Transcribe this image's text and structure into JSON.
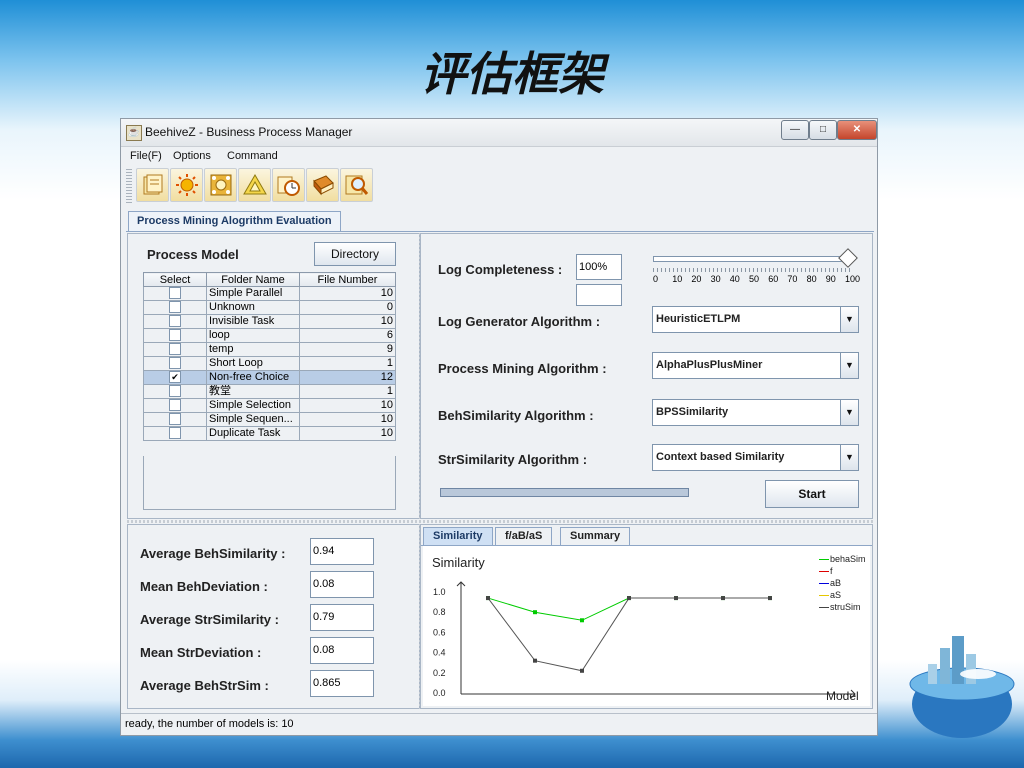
{
  "slide_title": "评估框架",
  "window": {
    "title": "BeehiveZ - Business Process Manager",
    "minimize": "—",
    "maximize": "□",
    "close": "✕"
  },
  "menu": [
    "File(F)",
    "Options",
    "Command"
  ],
  "toolbar_icons": [
    "document-icon",
    "sun-icon",
    "gear-icon",
    "triangle-icon",
    "clock-chart-icon",
    "book-icon",
    "magnifier-icon"
  ],
  "main_tab": "Process Mining Alogrithm Evaluation",
  "process_model": {
    "title": "Process Model",
    "directory_button": "Directory",
    "columns": [
      "Select",
      "Folder Name",
      "File Number"
    ],
    "rows": [
      {
        "checked": false,
        "name": "Simple Parallel",
        "count": "10"
      },
      {
        "checked": false,
        "name": "Unknown",
        "count": "0"
      },
      {
        "checked": false,
        "name": "Invisible Task",
        "count": "10"
      },
      {
        "checked": false,
        "name": "loop",
        "count": "6"
      },
      {
        "checked": false,
        "name": "temp",
        "count": "9"
      },
      {
        "checked": false,
        "name": "Short Loop",
        "count": "1"
      },
      {
        "checked": true,
        "name": "Non-free Choice",
        "count": "12"
      },
      {
        "checked": false,
        "name": "教堂",
        "count": "1"
      },
      {
        "checked": false,
        "name": "Simple Selection",
        "count": "10"
      },
      {
        "checked": false,
        "name": "Simple Sequen...",
        "count": "10"
      },
      {
        "checked": false,
        "name": "Duplicate Task",
        "count": "10"
      }
    ]
  },
  "settings": {
    "log_completeness_label": "Log Completeness :",
    "log_completeness_value": "100%",
    "log_completeness_extra": "",
    "slider_value": 100,
    "slider_ticks": [
      "0",
      "10",
      "20",
      "30",
      "40",
      "50",
      "60",
      "70",
      "80",
      "90",
      "100"
    ],
    "log_generator_label": "Log Generator Algorithm :",
    "log_generator_value": "HeuristicETLPM",
    "process_mining_label": "Process Mining Algorithm :",
    "process_mining_value": "AlphaPlusPlusMiner",
    "beh_similarity_label": "BehSimilarity Algorithm :",
    "beh_similarity_value": "BPSSimilarity",
    "str_similarity_label": "StrSimilarity Algorithm :",
    "str_similarity_value": "Context based Similarity",
    "progress": 0,
    "start_button": "Start"
  },
  "results": [
    {
      "label": "Average BehSimilarity :",
      "value": "0.94"
    },
    {
      "label": "Mean BehDeviation :",
      "value": "0.08"
    },
    {
      "label": "Average StrSimilarity :",
      "value": "0.79"
    },
    {
      "label": "Mean StrDeviation :",
      "value": "0.08"
    },
    {
      "label": "Average BehStrSim :",
      "value": "0.865"
    }
  ],
  "chart_tabs": [
    "Similarity",
    "f/aB/aS",
    "Summary"
  ],
  "status_text": "ready, the number of models is: 10",
  "colors": {
    "behaSim": "#00cc00",
    "f": "#dd0000",
    "aB": "#0000dd",
    "aS": "#e6c800",
    "struSim": "#444444"
  },
  "chart_data": {
    "type": "line",
    "title": "Similarity",
    "xlabel": "Model",
    "ylabel": "",
    "ylim": [
      0,
      1.0
    ],
    "yticks": [
      "0.0",
      "0.2",
      "0.4",
      "0.6",
      "0.8",
      "1.0"
    ],
    "x": [
      1,
      2,
      3,
      4,
      5,
      6,
      7
    ],
    "series": [
      {
        "name": "behaSim",
        "values": [
          0.94,
          0.8,
          0.72,
          0.94,
          0.94,
          0.94,
          0.94
        ]
      },
      {
        "name": "f",
        "values": []
      },
      {
        "name": "aB",
        "values": []
      },
      {
        "name": "aS",
        "values": []
      },
      {
        "name": "struSim",
        "values": [
          0.94,
          0.32,
          0.22,
          0.94,
          0.94,
          0.94,
          0.94
        ]
      }
    ]
  }
}
